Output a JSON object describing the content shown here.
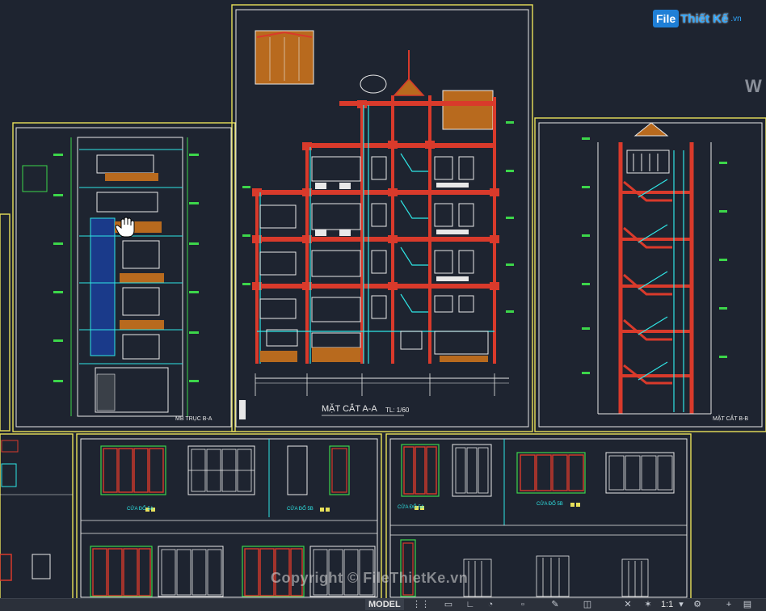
{
  "brand": {
    "logo_mark": "File",
    "logo_name": "Thiết Kế",
    "logo_domain": ".vn"
  },
  "drawing": {
    "main_title": "MẶT CẮT A-A",
    "main_scale": "TL: 1/60",
    "left_title": "MB TRỤC B-A",
    "right_title": "MẶT CẮT B-B",
    "door_labels": [
      "CỬA ĐỔ 5A",
      "CỬA ĐỔ 5B",
      "CỬA ĐỔ 5A",
      "CỬA ĐỔ 5B"
    ]
  },
  "watermark": "Copyright © FileThietKe.vn",
  "edge_letter": "W",
  "statusbar": {
    "model_tab": "MODEL",
    "scale": "1:1",
    "icons": [
      "grid-icon",
      "snap-icon",
      "orthogonal-icon",
      "polar-icon",
      "osnap-icon",
      "annotation-icon",
      "gear-icon",
      "plus-icon"
    ]
  },
  "colors": {
    "background": "#1e2430",
    "frame_yellow": "#e8e05a",
    "wall_red": "#d93a2b",
    "line_cyan": "#2fe6e6",
    "line_white": "#e8e8e8",
    "line_green": "#3cd64a",
    "fill_orange": "#b86a1e"
  }
}
